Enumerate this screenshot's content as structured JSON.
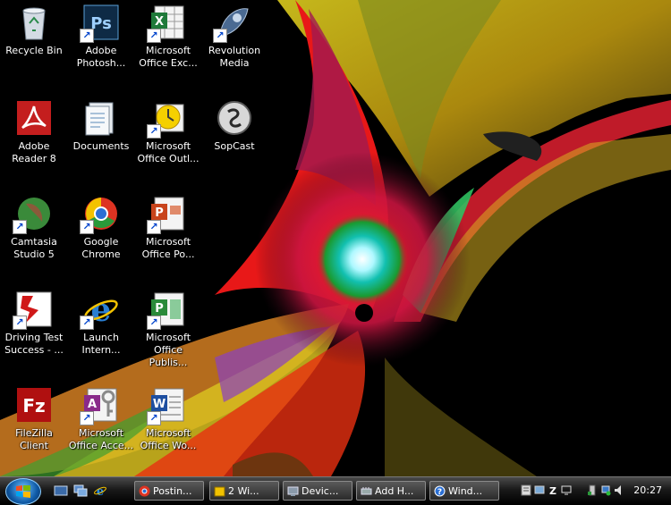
{
  "desktop": {
    "icons": [
      {
        "label": "Recycle Bin",
        "icon": "recycle-bin-icon",
        "color": "#c8cfd8"
      },
      {
        "label": "Adobe Photosh...",
        "icon": "photoshop-icon",
        "color": "#1f3d5c"
      },
      {
        "label": "Microsoft Office Exc...",
        "icon": "excel-icon",
        "color": "#1f7a3a"
      },
      {
        "label": "Revolution Media",
        "icon": "revolution-media-icon",
        "color": "#5a7aa0"
      },
      {
        "label": "Adobe Reader 8",
        "icon": "adobe-reader-icon",
        "color": "#c41e1e"
      },
      {
        "label": "Documents",
        "icon": "documents-icon",
        "color": "#9aa9b8"
      },
      {
        "label": "Microsoft Office Outl...",
        "icon": "outlook-icon",
        "color": "#e8b800"
      },
      {
        "label": "SopCast",
        "icon": "sopcast-icon",
        "color": "#9a9a9a"
      },
      {
        "label": "Camtasia Studio 5",
        "icon": "camtasia-icon",
        "color": "#3a8a3a"
      },
      {
        "label": "Google Chrome",
        "icon": "chrome-icon",
        "color": "#dd3322"
      },
      {
        "label": "Microsoft Office Po...",
        "icon": "powerpoint-icon",
        "color": "#c8441c"
      },
      {
        "label": "Driving Test Success - ...",
        "icon": "driving-test-icon",
        "color": "#d01818"
      },
      {
        "label": "Launch Intern...",
        "icon": "internet-explorer-icon",
        "color": "#2a7fd4"
      },
      {
        "label": "Microsoft Office Publis...",
        "icon": "publisher-icon",
        "color": "#2a8a3a"
      },
      {
        "label": "FileZilla Client",
        "icon": "filezilla-icon",
        "color": "#b01010"
      },
      {
        "label": "Microsoft Office Acce...",
        "icon": "access-icon",
        "color": "#8a2a8a"
      },
      {
        "label": "Microsoft Office Wo...",
        "icon": "word-icon",
        "color": "#1e4fa0"
      }
    ]
  },
  "taskbar": {
    "start_icon": "windows-start-orb-icon",
    "quick_launch": [
      "show-desktop-icon",
      "switch-windows-icon",
      "internet-explorer-icon"
    ],
    "tasks": [
      {
        "label": "Postin...",
        "icon": "chrome-icon"
      },
      {
        "label": "2 Wi...",
        "icon": "folder-icon"
      },
      {
        "label": "Devic...",
        "icon": "device-manager-icon"
      },
      {
        "label": "Add H...",
        "icon": "add-hardware-icon"
      },
      {
        "label": "Wind...",
        "icon": "help-icon"
      }
    ],
    "tray_icons": [
      "tray-app-icon",
      "tray-network-icon",
      "tray-filezilla-icon",
      "tray-monitor-icon",
      "tray-safely-remove-icon",
      "tray-network-status-icon",
      "tray-volume-icon"
    ],
    "clock": "20:27"
  }
}
